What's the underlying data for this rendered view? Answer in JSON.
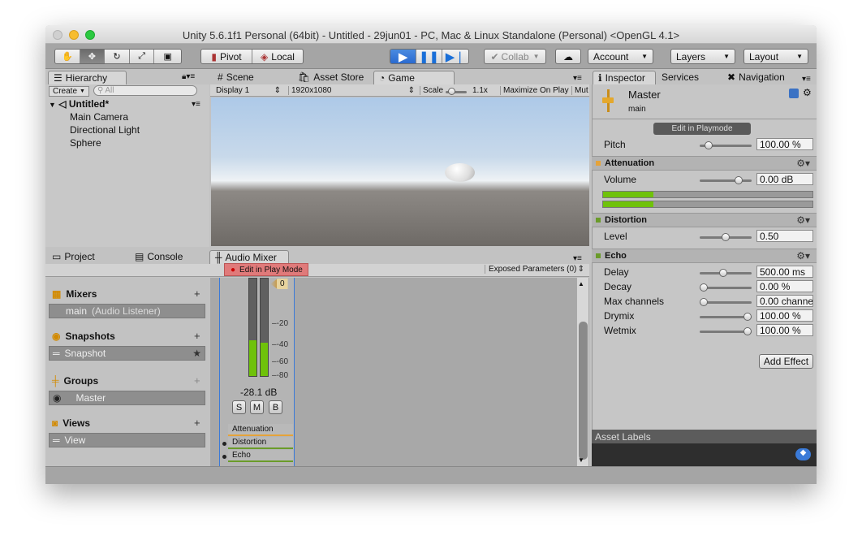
{
  "window": {
    "title": "Unity 5.6.1f1 Personal (64bit) - Untitled - 29jun01 - PC, Mac & Linux Standalone (Personal) <OpenGL 4.1>"
  },
  "colors": {
    "accent": "#2a6ad0",
    "meter_green": "#6fc20a",
    "attenuation": "#e5a33a",
    "distortion": "#6a9b2a",
    "echo": "#6a9b2a",
    "edit_play_red": "#e07a7a"
  },
  "toolbar": {
    "tools": [
      "hand-icon",
      "move-icon",
      "rotate-icon",
      "scale-icon",
      "rect-icon"
    ],
    "pivot": "Pivot",
    "local": "Local",
    "collab": "Collab",
    "account": "Account",
    "layers": "Layers",
    "layout": "Layout"
  },
  "hierarchy": {
    "tab": "Hierarchy",
    "create": "Create",
    "search_placeholder": "All",
    "scene": "Untitled*",
    "items": [
      "Main Camera",
      "Directional Light",
      "Sphere"
    ]
  },
  "scene_tabs": {
    "scene": "Scene",
    "asset_store": "Asset Store",
    "game": "Game"
  },
  "game_bar": {
    "display": "Display 1",
    "resolution": "1920x1080",
    "scale_label": "Scale",
    "scale_value": "1.1x",
    "maximize": "Maximize On Play",
    "mute": "Mut"
  },
  "bottom_tabs": {
    "project": "Project",
    "console": "Console",
    "audio_mixer": "Audio Mixer"
  },
  "mixer": {
    "edit_play_mode": "Edit in Play Mode",
    "exposed_params": "Exposed Parameters (0)",
    "mixers_title": "Mixers",
    "mixer_item": "main",
    "mixer_item_sub": "(Audio Listener)",
    "snapshots_title": "Snapshots",
    "snapshot_item": "Snapshot",
    "groups_title": "Groups",
    "group_item": "Master",
    "views_title": "Views",
    "view_item": "View",
    "meter_value": "0",
    "db_ticks": [
      "-20",
      "-40",
      "-60",
      "-80"
    ],
    "db_readout": "-28.1 dB",
    "smb": [
      "S",
      "M",
      "B"
    ],
    "effects": [
      "Attenuation",
      "Distortion",
      "Echo"
    ],
    "meter_levels": [
      0.37,
      0.34
    ]
  },
  "inspector": {
    "tabs": {
      "inspector": "Inspector",
      "services": "Services",
      "navigation": "Navigation"
    },
    "object": "Master",
    "sub": "main",
    "edit_playmode": "Edit in Playmode",
    "pitch_label": "Pitch",
    "pitch_value": "100.00 %",
    "pitch_level": 0.12,
    "attenuation": {
      "title": "Attenuation",
      "volume_label": "Volume",
      "volume_value": "0.00 dB",
      "volume_level": 0.8,
      "meter_levels": [
        0.24,
        0.24
      ]
    },
    "distortion": {
      "title": "Distortion",
      "level_label": "Level",
      "level_value": "0.50",
      "level_fraction": 0.5
    },
    "echo": {
      "title": "Echo",
      "params": [
        {
          "label": "Delay",
          "value": "500.00 ms",
          "fraction": 0.45
        },
        {
          "label": "Decay",
          "value": "0.00 %",
          "fraction": 0.0
        },
        {
          "label": "Max channels",
          "value": "0.00 channe",
          "fraction": 0.0
        },
        {
          "label": "Drymix",
          "value": "100.00 %",
          "fraction": 1.0
        },
        {
          "label": "Wetmix",
          "value": "100.00 %",
          "fraction": 1.0
        }
      ]
    },
    "add_effect": "Add Effect",
    "asset_labels": "Asset Labels"
  }
}
